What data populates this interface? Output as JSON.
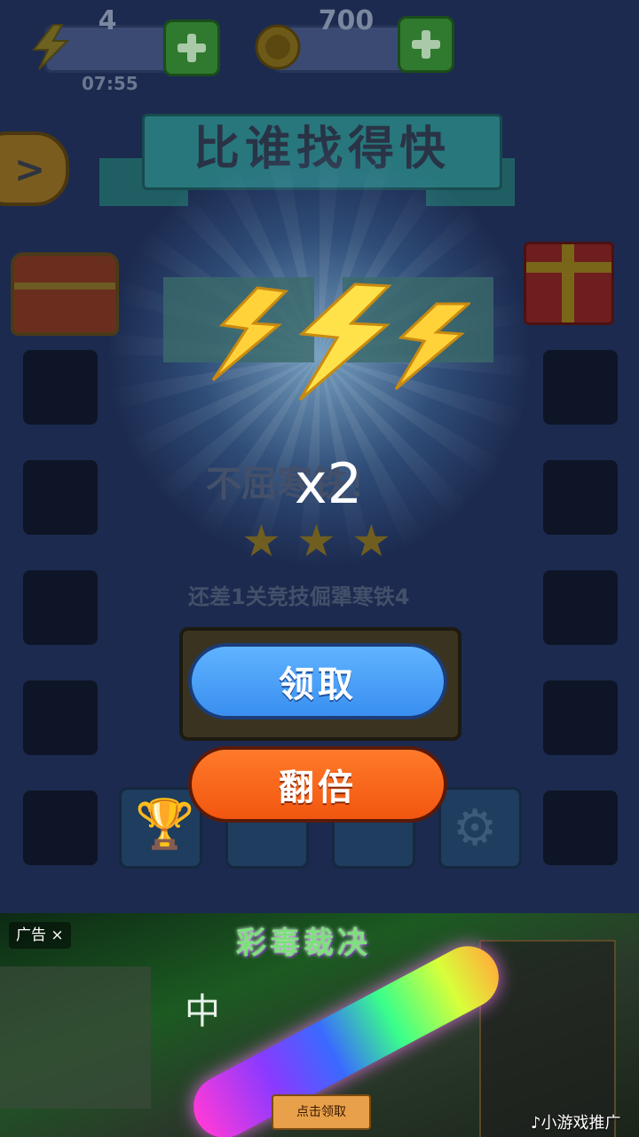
{
  "top_bar": {
    "energy": {
      "value": "4",
      "timer": "07:55"
    },
    "coins": {
      "value": "700"
    }
  },
  "title": "比谁找得快",
  "popup": {
    "reward_multiplier": "x2",
    "background_message": "不屈寒铁！",
    "stars": 3,
    "background_progress": "还差1关竞技倔犟寒铁4",
    "claim_label": "领取",
    "double_label": "翻倍"
  },
  "ad": {
    "tag": "广告 ×",
    "title": "彩毒裁决",
    "character": "中",
    "cta": "点击领取",
    "promo": "♪小游戏推广"
  },
  "colors": {
    "claim_button": "#3a8ff0",
    "double_button": "#f2560f",
    "reward_bolt": "#ffd23a"
  }
}
